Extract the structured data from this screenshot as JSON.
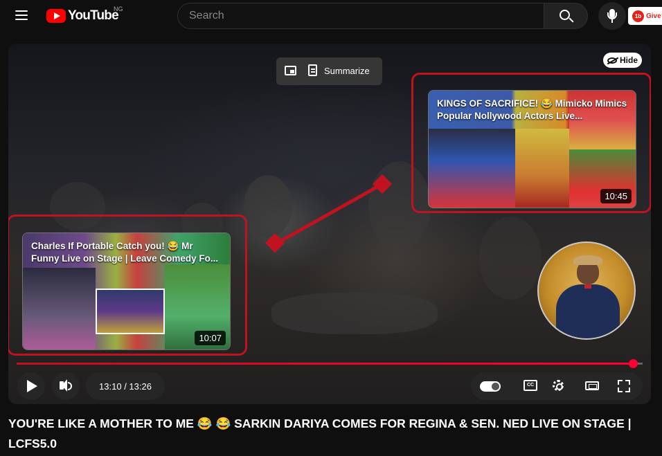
{
  "header": {
    "logo_text": "YouTube",
    "country_code": "NG",
    "search_placeholder": "Search",
    "extension_label": "Give",
    "extension_logo": "1b"
  },
  "player": {
    "pip_icon": "picture-in-picture-icon",
    "summarize_label": "Summarize",
    "hide_label": "Hide",
    "end_cards": [
      {
        "title": "KINGS OF SACRIFICE! 😂 Mimicko Mimics Popular Nollywood Actors Live...",
        "duration": "10:45"
      },
      {
        "title": "Charles If Portable Catch you! 😂 Mr Funny Live on Stage | Leave Comedy Fo...",
        "duration": "10:07"
      }
    ],
    "progress": 0.984,
    "time_display": "13:10 / 13:26",
    "controls": [
      "play-icon",
      "volume-icon",
      "autoplay-toggle",
      "cc-icon",
      "settings-icon",
      "theater-icon",
      "fullscreen-icon"
    ]
  },
  "video": {
    "title": "YOU'RE LIKE A MOTHER TO ME 😂 😂 SARKIN DARIYA COMES FOR REGINA & SEN. NED LIVE ON STAGE | LCFS5.0"
  },
  "colors": {
    "accent": "#ff0033",
    "annotation": "#c1121f",
    "background": "#0f0f0f"
  }
}
